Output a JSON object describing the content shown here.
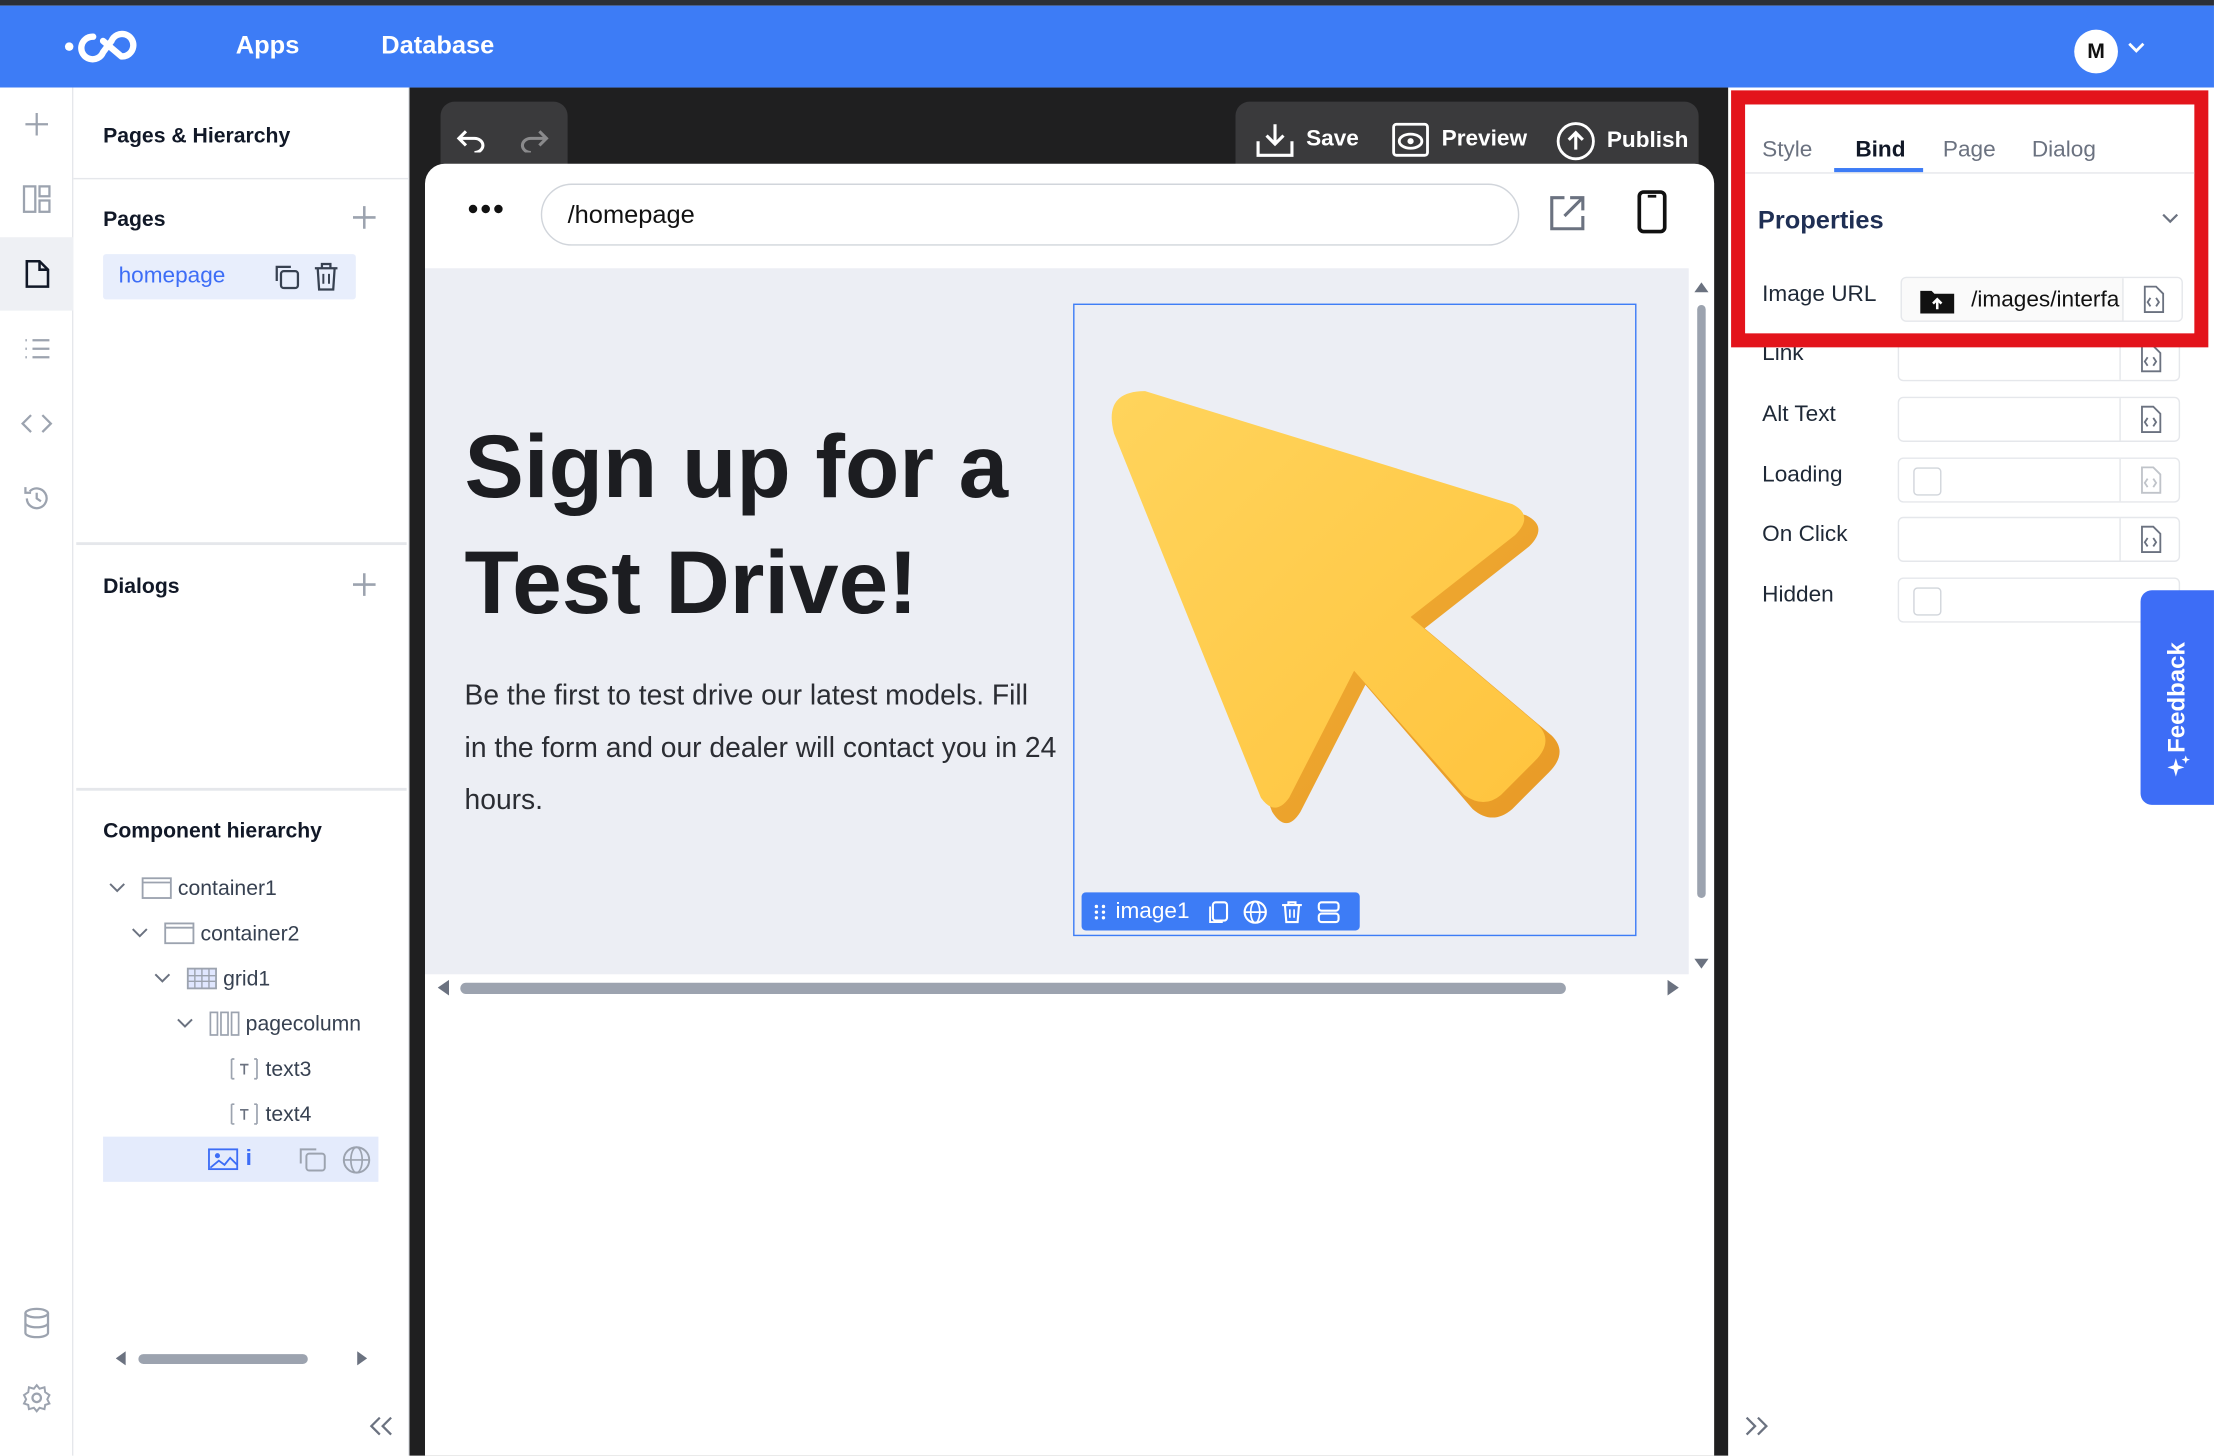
{
  "topbar": {
    "nav": [
      "Apps",
      "Database"
    ],
    "avatar_initial": "M",
    "brand_color": "#3d7cf6"
  },
  "left_panel": {
    "title": "Pages & Hierarchy",
    "pages_label": "Pages",
    "pages": [
      {
        "label": "homepage",
        "selected": true
      }
    ],
    "dialogs_label": "Dialogs",
    "hierarchy_label": "Component hierarchy",
    "tree": [
      {
        "label": "container1",
        "icon": "container-icon",
        "expanded": true
      },
      {
        "label": "container2",
        "icon": "container-icon",
        "expanded": true
      },
      {
        "label": "grid1",
        "icon": "grid-icon",
        "expanded": true
      },
      {
        "label": "pagecolumn",
        "icon": "column-icon",
        "expanded": true
      },
      {
        "label": "text3",
        "icon": "text-icon"
      },
      {
        "label": "text4",
        "icon": "text-icon"
      },
      {
        "label": "i",
        "icon": "image-icon",
        "selected": true
      }
    ]
  },
  "toolbar": {
    "save_label": "Save",
    "preview_label": "Preview",
    "publish_label": "Publish"
  },
  "preview": {
    "url": "/homepage",
    "hero_title": "Sign up for a Test Drive!",
    "hero_body": "Be the first to test drive our latest models. Fill in the form and our dealer will contact you in 24 hours.",
    "selected_component": "image1"
  },
  "right_panel": {
    "tabs": [
      {
        "label": "Style",
        "active": false
      },
      {
        "label": "Bind",
        "active": true
      },
      {
        "label": "Page",
        "active": false
      },
      {
        "label": "Dialog",
        "active": false
      }
    ],
    "section_title": "Properties",
    "properties": {
      "image_url_label": "Image URL",
      "image_url_value": "/images/interfa",
      "link_label": "Link",
      "alt_text_label": "Alt Text",
      "loading_label": "Loading",
      "on_click_label": "On Click",
      "hidden_label": "Hidden"
    },
    "feedback_label": "Feedback",
    "highlight_color": "#e3141b"
  }
}
